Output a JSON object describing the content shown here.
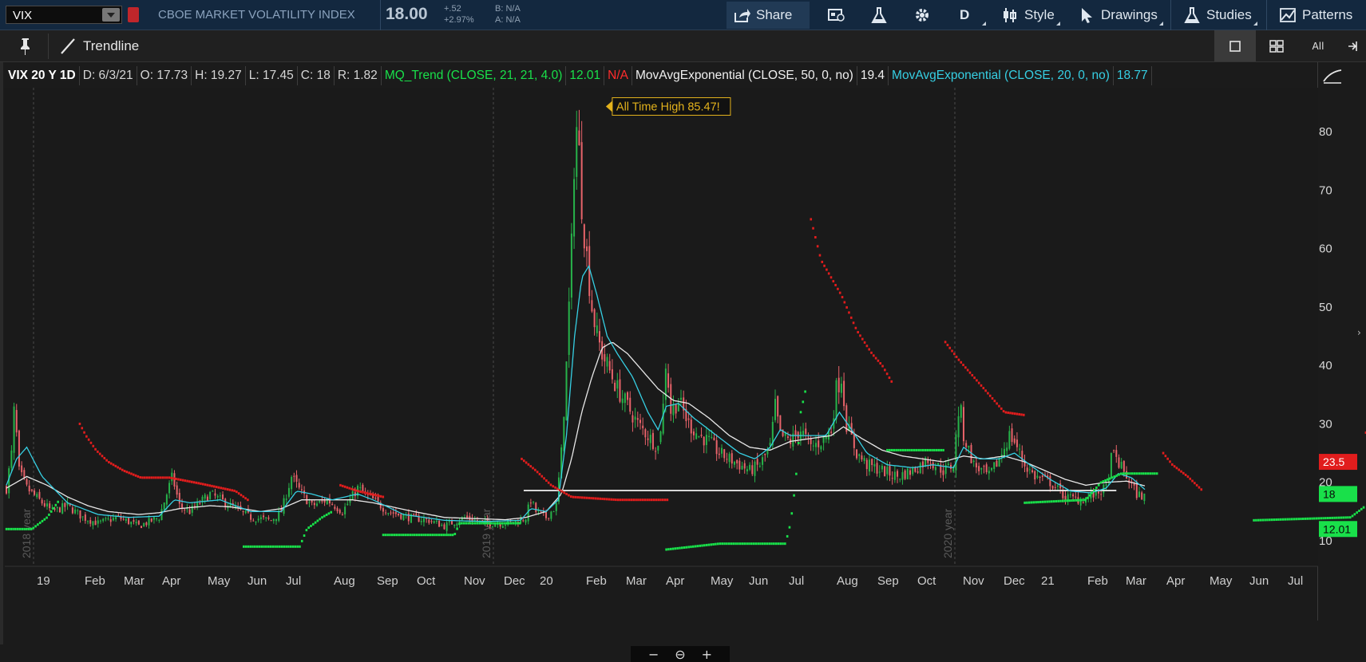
{
  "header": {
    "symbol": "VIX",
    "name": "CBOE MARKET VOLATILITY INDEX",
    "price": "18.00",
    "change": "+.52",
    "change_pct": "+2.97%",
    "bid": "B: N/A",
    "ask": "A: N/A",
    "buttons": {
      "share": "Share",
      "period": "D",
      "style": "Style",
      "drawings": "Drawings",
      "studies": "Studies",
      "patterns": "Patterns"
    },
    "colors": {
      "bar_bg": "#13283f",
      "text_muted": "#8aa2bd",
      "flag": "#c0262b"
    }
  },
  "toolbar2": {
    "trendline_label": "Trendline",
    "layout_all_label": "All"
  },
  "studyline": {
    "title": "VIX 20 Y 1D",
    "date": "D: 6/3/21",
    "open": "O: 17.73",
    "high": "H: 19.27",
    "low": "L: 17.45",
    "close": "C: 18",
    "range": "R: 1.82",
    "mq_trend": "MQ_Trend (CLOSE, 21, 21, 4.0)",
    "mq_value": "12.01",
    "mq_na": "N/A",
    "ema50": "MovAvgExponential (CLOSE, 50, 0, no)",
    "ema50_value": "19.4",
    "ema20": "MovAvgExponential (CLOSE, 20, 0, no)",
    "ema20_value": "18.77"
  },
  "chart_data": {
    "type": "candlestick",
    "series": [
      {
        "name": "VIX"
      },
      {
        "name": "MovAvgExponential (CLOSE, 50, 0, no)",
        "color": "#e8e8e8"
      },
      {
        "name": "MovAvgExponential (CLOSE, 20, 0, no)",
        "color": "#36cfe3"
      },
      {
        "name": "MQ_Trend upper",
        "color": "#e11d1d"
      },
      {
        "name": "MQ_Trend lower",
        "color": "#19e04a"
      }
    ],
    "x_labels": [
      "19",
      "Feb",
      "Mar",
      "Apr",
      "May",
      "Jun",
      "Jul",
      "Aug",
      "Sep",
      "Oct",
      "Nov",
      "Dec",
      "20",
      "Feb",
      "Mar",
      "Apr",
      "May",
      "Jun",
      "Jul",
      "Aug",
      "Sep",
      "Oct",
      "Nov",
      "Dec",
      "21",
      "Feb",
      "Mar",
      "Apr",
      "May",
      "Jun",
      "Jul"
    ],
    "y_ticks": [
      10,
      20,
      30,
      40,
      50,
      60,
      70,
      80
    ],
    "ylim": [
      5,
      90
    ],
    "year_markers": [
      "2018 year",
      "2019 year",
      "2020 year"
    ],
    "annotation": "All Time High 85.47!",
    "horizontal_line": 18.6,
    "price_tags": [
      {
        "label": "23.5",
        "value": 23.5,
        "color": "#e11d1d"
      },
      {
        "label": "18",
        "value": 18,
        "color": "#19e04a"
      },
      {
        "label": "12.01",
        "value": 12.01,
        "color": "#19e04a"
      }
    ],
    "close_anchor_points": [
      [
        0,
        19
      ],
      [
        6,
        26
      ],
      [
        8,
        34
      ],
      [
        12,
        22
      ],
      [
        20,
        19
      ],
      [
        32,
        17
      ],
      [
        45,
        15
      ],
      [
        60,
        16
      ],
      [
        75,
        14
      ],
      [
        90,
        13
      ],
      [
        110,
        14
      ],
      [
        130,
        12.5
      ],
      [
        150,
        14
      ],
      [
        163,
        21
      ],
      [
        170,
        16
      ],
      [
        180,
        15
      ],
      [
        200,
        18
      ],
      [
        220,
        16
      ],
      [
        240,
        14
      ],
      [
        260,
        13.5
      ],
      [
        270,
        15
      ],
      [
        280,
        21
      ],
      [
        290,
        18
      ],
      [
        300,
        16
      ],
      [
        315,
        17
      ],
      [
        330,
        15
      ],
      [
        345,
        19
      ],
      [
        360,
        17
      ],
      [
        375,
        15
      ],
      [
        395,
        14
      ],
      [
        415,
        13.5
      ],
      [
        430,
        12.5
      ],
      [
        450,
        14
      ],
      [
        470,
        13
      ],
      [
        490,
        13
      ],
      [
        505,
        13.5
      ],
      [
        510,
        14
      ],
      [
        515,
        17
      ],
      [
        520,
        15
      ],
      [
        530,
        14
      ],
      [
        540,
        16
      ],
      [
        545,
        25
      ],
      [
        550,
        40
      ],
      [
        555,
        60
      ],
      [
        558,
        78
      ],
      [
        561,
        82
      ],
      [
        564,
        70
      ],
      [
        568,
        62
      ],
      [
        575,
        50
      ],
      [
        580,
        45
      ],
      [
        585,
        42
      ],
      [
        590,
        40
      ],
      [
        600,
        36
      ],
      [
        610,
        33
      ],
      [
        620,
        30
      ],
      [
        630,
        28
      ],
      [
        640,
        26
      ],
      [
        645,
        33
      ],
      [
        648,
        42
      ],
      [
        652,
        32
      ],
      [
        660,
        34
      ],
      [
        670,
        30
      ],
      [
        680,
        28
      ],
      [
        690,
        27
      ],
      [
        700,
        25
      ],
      [
        710,
        24
      ],
      [
        720,
        23
      ],
      [
        730,
        22
      ],
      [
        740,
        23
      ],
      [
        750,
        26
      ],
      [
        755,
        33
      ],
      [
        760,
        28
      ],
      [
        770,
        27
      ],
      [
        780,
        29
      ],
      [
        790,
        26
      ],
      [
        800,
        27
      ],
      [
        810,
        29
      ],
      [
        815,
        36
      ],
      [
        820,
        38
      ],
      [
        825,
        30
      ],
      [
        835,
        25
      ],
      [
        845,
        23
      ],
      [
        860,
        22
      ],
      [
        875,
        21
      ],
      [
        890,
        22
      ],
      [
        905,
        24
      ],
      [
        920,
        22
      ],
      [
        930,
        23
      ],
      [
        936,
        34
      ],
      [
        940,
        28
      ],
      [
        950,
        23
      ],
      [
        965,
        21
      ],
      [
        975,
        24
      ],
      [
        985,
        28
      ],
      [
        990,
        27
      ],
      [
        1000,
        23
      ],
      [
        1010,
        21
      ],
      [
        1025,
        20
      ],
      [
        1040,
        17.5
      ],
      [
        1055,
        17
      ],
      [
        1070,
        18
      ],
      [
        1080,
        19
      ],
      [
        1086,
        25
      ],
      [
        1090,
        24
      ],
      [
        1100,
        21
      ],
      [
        1110,
        18
      ],
      [
        1118,
        17.5
      ]
    ],
    "ema50_anchor_points": [
      [
        0,
        19
      ],
      [
        20,
        21
      ],
      [
        40,
        19.5
      ],
      [
        60,
        17.5
      ],
      [
        80,
        16
      ],
      [
        100,
        15
      ],
      [
        130,
        14.5
      ],
      [
        150,
        14.8
      ],
      [
        170,
        15.5
      ],
      [
        200,
        16
      ],
      [
        220,
        15.8
      ],
      [
        250,
        15
      ],
      [
        270,
        15.5
      ],
      [
        290,
        17
      ],
      [
        310,
        17
      ],
      [
        340,
        17
      ],
      [
        360,
        16.5
      ],
      [
        400,
        15
      ],
      [
        430,
        14
      ],
      [
        460,
        13.8
      ],
      [
        490,
        13.6
      ],
      [
        510,
        14
      ],
      [
        530,
        15
      ],
      [
        545,
        18
      ],
      [
        555,
        24
      ],
      [
        565,
        32
      ],
      [
        575,
        38
      ],
      [
        585,
        43
      ],
      [
        595,
        44
      ],
      [
        610,
        42
      ],
      [
        625,
        39
      ],
      [
        640,
        36
      ],
      [
        655,
        34
      ],
      [
        670,
        33.5
      ],
      [
        690,
        31
      ],
      [
        710,
        28
      ],
      [
        730,
        26
      ],
      [
        750,
        25.5
      ],
      [
        770,
        27
      ],
      [
        790,
        27.5
      ],
      [
        810,
        28
      ],
      [
        822,
        29.5
      ],
      [
        840,
        27.5
      ],
      [
        860,
        25.5
      ],
      [
        880,
        24.5
      ],
      [
        900,
        24
      ],
      [
        920,
        23.5
      ],
      [
        940,
        24.5
      ],
      [
        960,
        24
      ],
      [
        980,
        24.5
      ],
      [
        1000,
        23.5
      ],
      [
        1020,
        22
      ],
      [
        1040,
        20.5
      ],
      [
        1060,
        19.5
      ],
      [
        1080,
        20
      ],
      [
        1100,
        20.2
      ],
      [
        1118,
        19.4
      ]
    ],
    "ema20_anchor_points": [
      [
        0,
        19.5
      ],
      [
        10,
        24
      ],
      [
        20,
        26
      ],
      [
        35,
        21
      ],
      [
        60,
        16.5
      ],
      [
        90,
        14.5
      ],
      [
        120,
        14
      ],
      [
        150,
        14.2
      ],
      [
        165,
        17
      ],
      [
        180,
        16.5
      ],
      [
        210,
        17
      ],
      [
        240,
        15
      ],
      [
        270,
        15
      ],
      [
        285,
        18.5
      ],
      [
        300,
        18
      ],
      [
        320,
        17
      ],
      [
        345,
        18
      ],
      [
        360,
        17
      ],
      [
        390,
        14.5
      ],
      [
        430,
        13.5
      ],
      [
        470,
        13.3
      ],
      [
        505,
        13.5
      ],
      [
        515,
        15.5
      ],
      [
        530,
        15
      ],
      [
        542,
        17
      ],
      [
        550,
        28
      ],
      [
        558,
        45
      ],
      [
        565,
        55
      ],
      [
        572,
        57
      ],
      [
        580,
        52
      ],
      [
        590,
        45
      ],
      [
        600,
        42
      ],
      [
        615,
        38
      ],
      [
        630,
        32
      ],
      [
        640,
        29
      ],
      [
        648,
        33
      ],
      [
        660,
        33.5
      ],
      [
        675,
        31
      ],
      [
        690,
        29
      ],
      [
        705,
        27
      ],
      [
        720,
        25
      ],
      [
        735,
        24
      ],
      [
        750,
        26
      ],
      [
        760,
        29
      ],
      [
        770,
        28
      ],
      [
        790,
        28
      ],
      [
        805,
        28
      ],
      [
        818,
        32
      ],
      [
        830,
        29
      ],
      [
        845,
        25
      ],
      [
        865,
        23
      ],
      [
        890,
        22.5
      ],
      [
        910,
        23
      ],
      [
        930,
        22.5
      ],
      [
        940,
        26
      ],
      [
        955,
        24
      ],
      [
        975,
        24
      ],
      [
        990,
        25
      ],
      [
        1005,
        23
      ],
      [
        1025,
        20.5
      ],
      [
        1045,
        18.5
      ],
      [
        1065,
        18.2
      ],
      [
        1080,
        19
      ],
      [
        1092,
        21.5
      ],
      [
        1105,
        20.8
      ],
      [
        1118,
        18.77
      ]
    ],
    "mq_red_segments": [
      [
        [
          72,
          30
        ],
        [
          78,
          28
        ],
        [
          88,
          25.5
        ],
        [
          100,
          23.5
        ],
        [
          115,
          22
        ],
        [
          132,
          20.8
        ],
        [
          160,
          20.8
        ],
        [
          190,
          19.8
        ],
        [
          225,
          18.5
        ],
        [
          237,
          17
        ]
      ],
      [
        [
          328,
          19.5
        ],
        [
          345,
          18.5
        ],
        [
          370,
          17.5
        ]
      ],
      [
        [
          506,
          24
        ],
        [
          520,
          22
        ],
        [
          535,
          19.5
        ],
        [
          555,
          17.5
        ],
        [
          600,
          17
        ],
        [
          650,
          17
        ]
      ],
      [
        [
          790,
          65
        ],
        [
          800,
          58
        ],
        [
          820,
          52
        ],
        [
          835,
          46
        ],
        [
          850,
          42
        ],
        [
          860,
          40
        ],
        [
          870,
          37
        ]
      ],
      [
        [
          922,
          44
        ],
        [
          935,
          41
        ],
        [
          950,
          38
        ],
        [
          965,
          35
        ],
        [
          980,
          32
        ],
        [
          1000,
          31.5
        ]
      ],
      [
        [
          1136,
          25
        ],
        [
          1145,
          23
        ],
        [
          1160,
          21
        ],
        [
          1175,
          18.5
        ]
      ],
      [
        [
          1335,
          28.5
        ],
        [
          1345,
          26.5
        ],
        [
          1360,
          24.5
        ],
        [
          1375,
          23.5
        ],
        [
          1390,
          23.5
        ]
      ]
    ],
    "mq_green_segments": [
      [
        [
          0,
          12
        ],
        [
          25,
          12
        ],
        [
          40,
          14
        ],
        [
          48,
          16
        ],
        [
          52,
          17
        ]
      ],
      [
        [
          233,
          9
        ],
        [
          288,
          9
        ],
        [
          295,
          12
        ],
        [
          310,
          14
        ],
        [
          320,
          15
        ]
      ],
      [
        [
          370,
          11
        ],
        [
          440,
          11
        ],
        [
          445,
          13
        ],
        [
          505,
          13
        ]
      ],
      [
        [
          648,
          8.5
        ],
        [
          700,
          9.5
        ],
        [
          765,
          9.5
        ],
        [
          770,
          13
        ],
        [
          775,
          20
        ],
        [
          780,
          32
        ],
        [
          785,
          36
        ]
      ],
      [
        [
          865,
          25.5
        ],
        [
          922,
          25.5
        ]
      ],
      [
        [
          1000,
          16.5
        ],
        [
          1060,
          17
        ],
        [
          1075,
          20
        ],
        [
          1095,
          21.5
        ],
        [
          1130,
          21.5
        ]
      ],
      [
        [
          1225,
          13.5
        ],
        [
          1320,
          14
        ],
        [
          1335,
          16
        ]
      ],
      [
        [
          1392,
          11
        ],
        [
          1430,
          11
        ]
      ]
    ]
  },
  "footer": {
    "zoom_minus": "−",
    "zoom_reset": "⊖",
    "zoom_plus": "+"
  }
}
